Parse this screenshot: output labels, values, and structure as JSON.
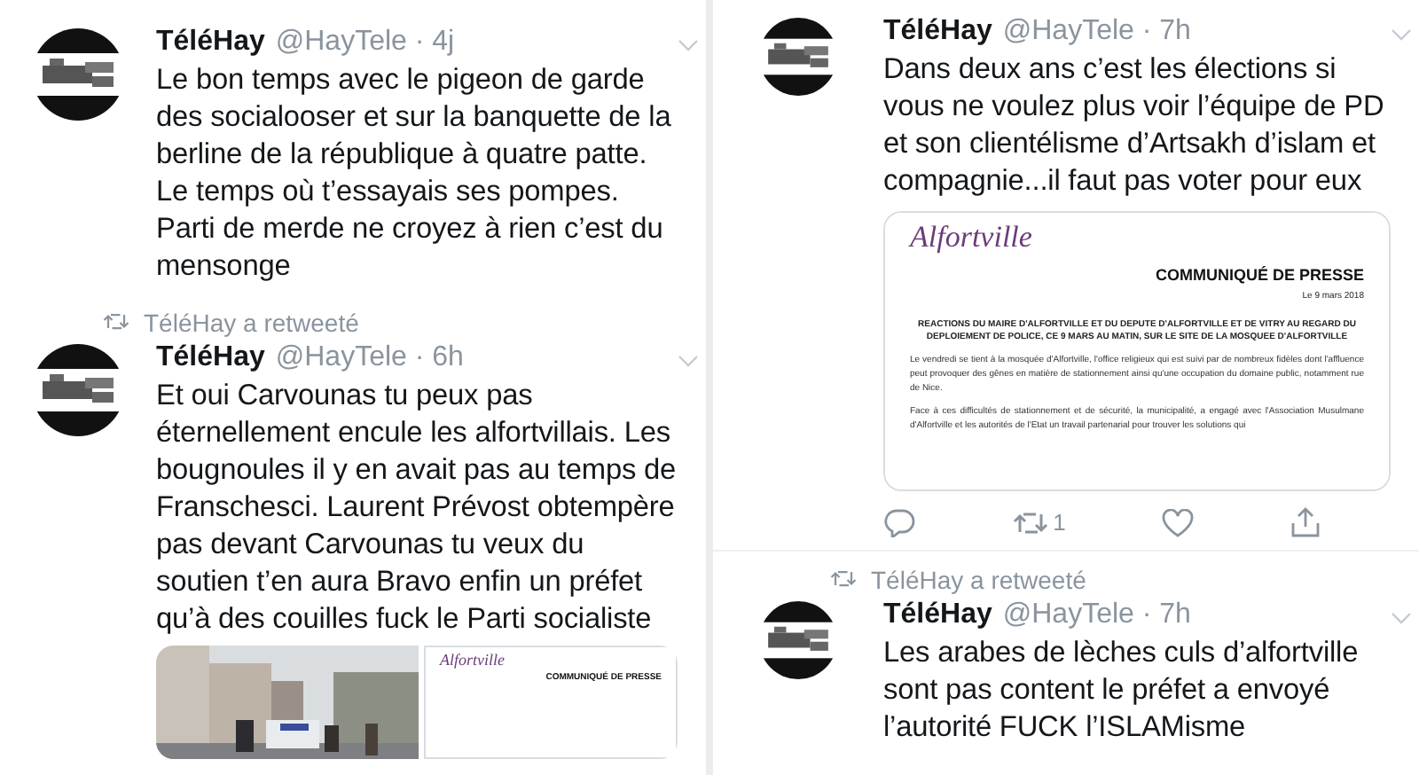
{
  "columns": [
    {
      "tweets": [
        {
          "name": "TéléHay",
          "handle": "@HayTele · 4j",
          "text": "Le bon temps avec le pigeon de garde des socialooser et sur la banquette de la berline de la république à quatre patte. Le temps où t’essayais ses pompes. Parti de merde ne croyez à rien c’est du mensonge"
        },
        {
          "retweet_label": "TéléHay a retweeté",
          "name": "TéléHay",
          "handle": "@HayTele · 6h",
          "text": "Et oui Carvounas tu peux pas éternellement encule les alfortvillais. Les bougnoules il y en avait pas au temps de Franschesci. Laurent Prévost obtempère pas devant Carvounas tu veux du soutien t’en aura Bravo enfin un préfet qu’à des couilles fuck le Parti socialiste",
          "media": [
            {
              "kind": "picture"
            },
            {
              "kind": "document",
              "logo": "Alfortville",
              "title": "COMMUNIQUÉ DE PRESSE"
            }
          ]
        }
      ]
    },
    {
      "tweets": [
        {
          "name": "TéléHay",
          "handle": "@HayTele · 7h",
          "text": "Dans deux ans c’est les élections si vous ne voulez plus voir l’équipe de PD et son clientélisme d’Artsakh d’islam et compagnie...il faut pas voter pour eux",
          "media": [
            {
              "kind": "document",
              "logo": "Alfortville",
              "title": "COMMUNIQUÉ DE PRESSE",
              "date": "Le 9 mars 2018",
              "heading": "REACTIONS DU MAIRE D'ALFORTVILLE ET DU DEPUTE D'ALFORTVILLE ET DE VITRY AU REGARD DU DEPLOIEMENT DE POLICE, CE 9 MARS AU MATIN, SUR LE SITE DE LA MOSQUEE D'ALFORTVILLE",
              "paragraphs": [
                "Le vendredi se tient à la mosquée d'Alfortville, l'office religieux qui est suivi par de nombreux fidèles dont l'affluence peut provoquer des gênes en matière de stationnement ainsi qu'une occupation du domaine public, notamment rue de Nice.",
                "Face à ces difficultés de stationnement et de sécurité, la municipalité, a engagé avec l'Association Musulmane d'Alfortville et les autorités de l'Etat un travail partenarial pour trouver les solutions qui"
              ]
            }
          ],
          "actions": {
            "retweets": "1"
          }
        },
        {
          "retweet_label": "TéléHay a retweeté",
          "name": "TéléHay",
          "handle": "@HayTele · 7h",
          "text": "Les arabes de lèches culs d’alfortville sont pas content le préfet a envoyé l’autorité FUCK l’ISLAMisme"
        }
      ]
    }
  ]
}
